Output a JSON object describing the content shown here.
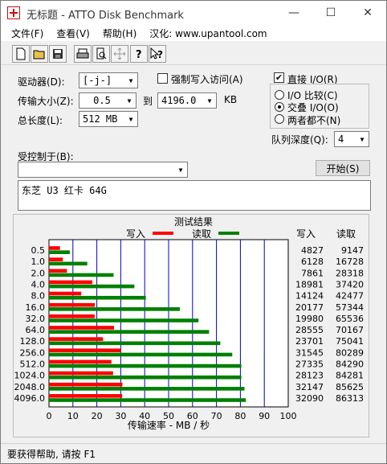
{
  "window": {
    "title": "无标题 - ATTO Disk Benchmark",
    "minimize_glyph": "—",
    "maximize_glyph": "☐",
    "close_glyph": "✕"
  },
  "menu": [
    "文件(F)",
    "查看(V)",
    "帮助(H)",
    "汉化: www.upantool.com"
  ],
  "toolbar": [
    {
      "name": "new-icon",
      "glyph": "🗋"
    },
    {
      "name": "open-icon",
      "glyph": "📂"
    },
    {
      "name": "save-icon",
      "glyph": "💾"
    },
    {
      "name": "print-icon",
      "glyph": "🖶"
    },
    {
      "name": "print-preview-icon",
      "glyph": "🔍"
    },
    {
      "name": "move-icon",
      "glyph": "✥"
    },
    {
      "name": "help-icon",
      "glyph": "?"
    },
    {
      "name": "context-help-icon",
      "glyph": "?"
    }
  ],
  "form": {
    "drive_label": "驱动器(D):",
    "drive_value": "[-j-]",
    "force_write_label": "强制写入访问(A)",
    "force_write_checked": false,
    "direct_io_label": "直接 I/O(R)",
    "direct_io_checked": true,
    "transfer_label": "传输大小(Z):",
    "transfer_from": "0.5",
    "transfer_to_label": "到",
    "transfer_to": "4196.0",
    "transfer_unit": "KB",
    "length_label": "总长度(L):",
    "length_value": "512 MB",
    "io_options": [
      {
        "label": "I/O 比较(C)",
        "selected": false
      },
      {
        "label": "交叠 I/O(O)",
        "selected": true
      },
      {
        "label": "两者都不(N)",
        "selected": false
      }
    ],
    "queue_label": "队列深度(Q):",
    "queue_value": "4",
    "controlled_label": "受控制于(B):",
    "controlled_value": "",
    "start_button": "开始(S)",
    "description": "东芝 U3 红卡 64G"
  },
  "results": {
    "title": "测试结果",
    "legend_write": "写入",
    "legend_read": "读取",
    "col_write": "写入",
    "col_read": "读取"
  },
  "chart_data": {
    "type": "bar",
    "orientation": "horizontal",
    "xlabel": "传输速率 - MB / 秒",
    "xlim": [
      0,
      100
    ],
    "xticks": [
      0,
      10,
      20,
      30,
      40,
      50,
      60,
      70,
      80,
      90,
      100
    ],
    "categories": [
      "0.5",
      "1.0",
      "2.0",
      "4.0",
      "8.0",
      "16.0",
      "32.0",
      "64.0",
      "128.0",
      "256.0",
      "512.0",
      "1024.0",
      "2048.0",
      "4096.0"
    ],
    "series": [
      {
        "name": "写入",
        "color": "#ff0000",
        "values": [
          4.6,
          5.8,
          7.5,
          18.1,
          13.5,
          19.2,
          19.1,
          27.2,
          22.6,
          30.0,
          26.1,
          26.8,
          30.7,
          30.6
        ]
      },
      {
        "name": "读取",
        "color": "#008000",
        "values": [
          8.7,
          16.0,
          27.0,
          35.7,
          40.5,
          54.7,
          62.5,
          66.9,
          71.6,
          76.6,
          80.4,
          80.4,
          81.7,
          82.3
        ]
      }
    ],
    "table_write": [
      "4827",
      "6128",
      "7861",
      "18981",
      "14124",
      "20177",
      "19980",
      "28555",
      "23701",
      "31545",
      "27335",
      "28123",
      "32147",
      "32090"
    ],
    "table_read": [
      "9147",
      "16728",
      "28318",
      "37420",
      "42477",
      "57344",
      "65536",
      "70167",
      "75041",
      "80289",
      "84290",
      "84281",
      "85625",
      "86313"
    ],
    "colors": {
      "write": "#ff0000",
      "read": "#008000",
      "grid": "#0000cc"
    }
  },
  "status": {
    "text": "要获得帮助, 请按 F1"
  }
}
